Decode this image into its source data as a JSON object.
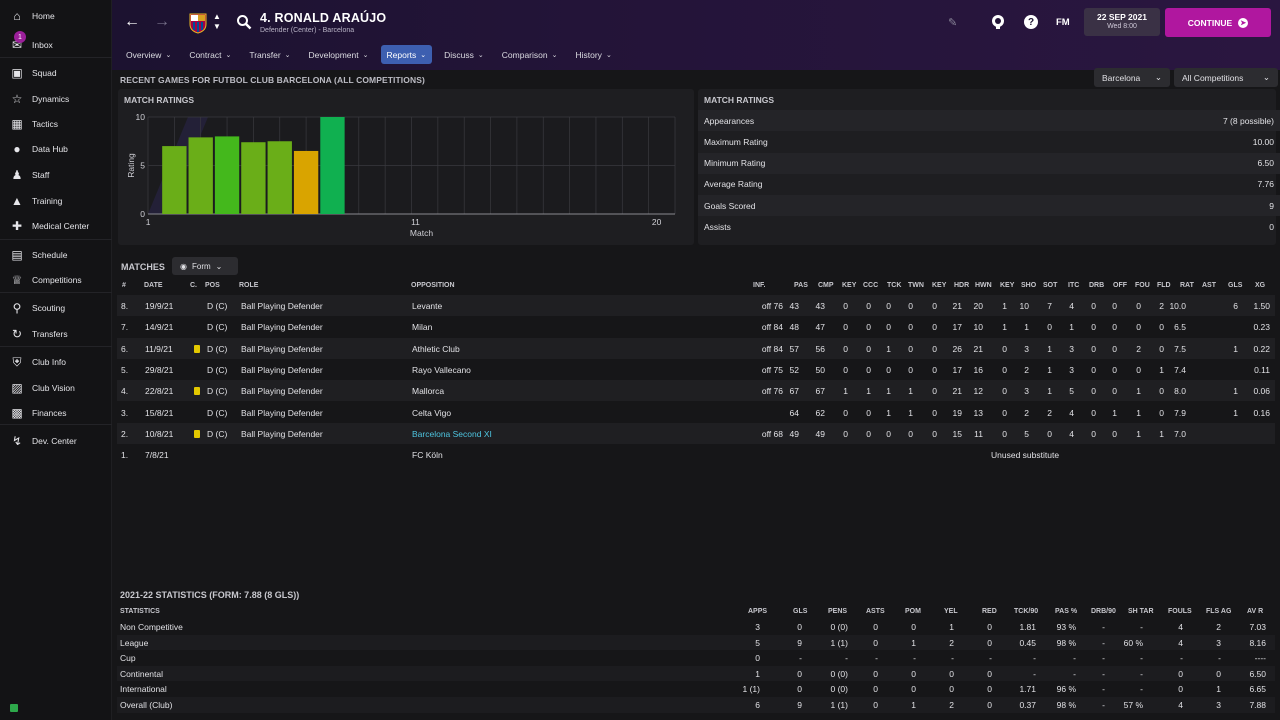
{
  "sidebar": {
    "items": [
      {
        "label": "Home",
        "icon": "home-icon"
      },
      {
        "label": "Inbox",
        "icon": "inbox-icon",
        "badge": "1"
      },
      {
        "label": "Squad",
        "icon": "squad-icon"
      },
      {
        "label": "Dynamics",
        "icon": "dynamics-icon"
      },
      {
        "label": "Tactics",
        "icon": "tactics-icon"
      },
      {
        "label": "Data Hub",
        "icon": "data-hub-icon"
      },
      {
        "label": "Staff",
        "icon": "staff-icon"
      },
      {
        "label": "Training",
        "icon": "training-icon"
      },
      {
        "label": "Medical Center",
        "icon": "medical-icon"
      },
      {
        "label": "Schedule",
        "icon": "calendar-icon"
      },
      {
        "label": "Competitions",
        "icon": "trophy-icon"
      },
      {
        "label": "Scouting",
        "icon": "scouting-icon"
      },
      {
        "label": "Transfers",
        "icon": "transfers-icon"
      },
      {
        "label": "Club Info",
        "icon": "shield-icon"
      },
      {
        "label": "Club Vision",
        "icon": "vision-icon"
      },
      {
        "label": "Finances",
        "icon": "finances-icon"
      },
      {
        "label": "Dev. Center",
        "icon": "dev-center-icon"
      }
    ]
  },
  "header": {
    "player_name": "4. RONALD ARAÚJO",
    "player_sub": "Defender (Center) - Barcelona",
    "date_main": "22 SEP 2021",
    "date_sub": "Wed 8:00",
    "continue_label": "CONTINUE",
    "fm_label": "FM",
    "tabs": [
      {
        "label": "Overview",
        "active": false
      },
      {
        "label": "Contract",
        "active": false
      },
      {
        "label": "Transfer",
        "active": false
      },
      {
        "label": "Development",
        "active": false
      },
      {
        "label": "Reports",
        "active": true
      },
      {
        "label": "Discuss",
        "active": false
      },
      {
        "label": "Comparison",
        "active": false
      },
      {
        "label": "History",
        "active": false
      }
    ]
  },
  "recent": {
    "title": "RECENT GAMES FOR FUTBOL CLUB BARCELONA (ALL COMPETITIONS)",
    "club_dd": "Barcelona",
    "comp_dd": "All Competitions"
  },
  "chart_panel_title": "MATCH RATINGS",
  "chart_data": {
    "type": "bar",
    "title": "MATCH RATINGS",
    "xlabel": "Match",
    "ylabel": "Rating",
    "ylim": [
      0,
      10
    ],
    "xlim": [
      1,
      20
    ],
    "x_ticks": [
      "1",
      "11",
      "20"
    ],
    "y_ticks": [
      "0",
      "5",
      "10"
    ],
    "categories": [
      1,
      2,
      3,
      4,
      5,
      6,
      7
    ],
    "values": [
      7.0,
      7.9,
      8.0,
      7.4,
      7.5,
      6.5,
      10.0
    ],
    "colors": [
      "#6aae18",
      "#6aae18",
      "#44b81c",
      "#6aae18",
      "#6aae18",
      "#d9a400",
      "#10b050"
    ]
  },
  "ratings": {
    "title": "MATCH RATINGS",
    "rows": [
      {
        "label": "Appearances",
        "value": "7 (8 possible)"
      },
      {
        "label": "Maximum Rating",
        "value": "10.00"
      },
      {
        "label": "Minimum Rating",
        "value": "6.50"
      },
      {
        "label": "Average Rating",
        "value": "7.76"
      },
      {
        "label": "Goals Scored",
        "value": "9"
      },
      {
        "label": "Assists",
        "value": "0"
      }
    ]
  },
  "matches": {
    "title": "MATCHES",
    "form_label": "Form",
    "headers": [
      "#",
      "DATE",
      "C.",
      "POS",
      "ROLE",
      "OPPOSITION",
      "INF.",
      "PAS",
      "CMP",
      "KEY",
      "CCC",
      "TCK",
      "TWN",
      "KEY",
      "HDR",
      "HWN",
      "KEY",
      "SHO",
      "SOT",
      "ITC",
      "DRB",
      "OFF",
      "FOU",
      "FLD",
      "RAT",
      "AST",
      "GLS",
      "XG"
    ],
    "rows": [
      {
        "num": "8.",
        "date": "19/9/21",
        "card": false,
        "pos": "D (C)",
        "role": "Ball Playing Defender",
        "opp": "Levante",
        "link": false,
        "inf": "off 76",
        "vals": [
          "43",
          "43",
          "0",
          "0",
          "0",
          "0",
          "0",
          "21",
          "20",
          "1",
          "10",
          "7",
          "4",
          "0",
          "0",
          "0",
          "2",
          "10.0",
          "",
          "6",
          "1.50"
        ]
      },
      {
        "num": "7.",
        "date": "14/9/21",
        "card": false,
        "pos": "D (C)",
        "role": "Ball Playing Defender",
        "opp": "Milan",
        "link": false,
        "inf": "off 84",
        "vals": [
          "48",
          "47",
          "0",
          "0",
          "0",
          "0",
          "0",
          "17",
          "10",
          "1",
          "1",
          "0",
          "1",
          "0",
          "0",
          "0",
          "0",
          "6.5",
          "",
          "",
          "0.23"
        ]
      },
      {
        "num": "6.",
        "date": "11/9/21",
        "card": true,
        "pos": "D (C)",
        "role": "Ball Playing Defender",
        "opp": "Athletic Club",
        "link": false,
        "inf": "off 84",
        "vals": [
          "57",
          "56",
          "0",
          "0",
          "1",
          "0",
          "0",
          "26",
          "21",
          "0",
          "3",
          "1",
          "3",
          "0",
          "0",
          "2",
          "0",
          "7.5",
          "",
          "1",
          "0.22"
        ]
      },
      {
        "num": "5.",
        "date": "29/8/21",
        "card": false,
        "pos": "D (C)",
        "role": "Ball Playing Defender",
        "opp": "Rayo Vallecano",
        "link": false,
        "inf": "off 75",
        "vals": [
          "52",
          "50",
          "0",
          "0",
          "0",
          "0",
          "0",
          "17",
          "16",
          "0",
          "2",
          "1",
          "3",
          "0",
          "0",
          "0",
          "1",
          "7.4",
          "",
          "",
          "0.11"
        ]
      },
      {
        "num": "4.",
        "date": "22/8/21",
        "card": true,
        "pos": "D (C)",
        "role": "Ball Playing Defender",
        "opp": "Mallorca",
        "link": false,
        "inf": "off 76",
        "vals": [
          "67",
          "67",
          "1",
          "1",
          "1",
          "1",
          "0",
          "21",
          "12",
          "0",
          "3",
          "1",
          "5",
          "0",
          "0",
          "1",
          "0",
          "8.0",
          "",
          "1",
          "0.06"
        ]
      },
      {
        "num": "3.",
        "date": "15/8/21",
        "card": false,
        "pos": "D (C)",
        "role": "Ball Playing Defender",
        "opp": "Celta Vigo",
        "link": false,
        "inf": "",
        "vals": [
          "64",
          "62",
          "0",
          "0",
          "1",
          "1",
          "0",
          "19",
          "13",
          "0",
          "2",
          "2",
          "4",
          "0",
          "1",
          "1",
          "0",
          "7.9",
          "",
          "1",
          "0.16"
        ]
      },
      {
        "num": "2.",
        "date": "10/8/21",
        "card": true,
        "pos": "D (C)",
        "role": "Ball Playing Defender",
        "opp": "Barcelona Second XI",
        "link": true,
        "inf": "off 68",
        "vals": [
          "49",
          "49",
          "0",
          "0",
          "0",
          "0",
          "0",
          "15",
          "11",
          "0",
          "5",
          "0",
          "4",
          "0",
          "0",
          "1",
          "1",
          "7.0",
          "",
          "",
          ""
        ]
      }
    ],
    "last_row": {
      "num": "1.",
      "date": "7/8/21",
      "opp": "FC Köln",
      "note": "Unused substitute"
    }
  },
  "season_stats": {
    "title": "2021-22 STATISTICS (FORM: 7.88 (8 GLS))",
    "headers": [
      "STATISTICS",
      "APPS",
      "GLS",
      "PENS",
      "ASTS",
      "POM",
      "YEL",
      "RED",
      "TCK/90",
      "PAS %",
      "DRB/90",
      "SH TAR",
      "FOULS",
      "FLS AG",
      "AV R"
    ],
    "rows": [
      {
        "name": "Non Competitive",
        "vals": [
          "3",
          "0",
          "0 (0)",
          "0",
          "0",
          "1",
          "0",
          "1.81",
          "93 %",
          "-",
          "-",
          "4",
          "2",
          "7.03"
        ]
      },
      {
        "name": "League",
        "vals": [
          "5",
          "9",
          "1 (1)",
          "0",
          "1",
          "2",
          "0",
          "0.45",
          "98 %",
          "-",
          "60 %",
          "4",
          "3",
          "8.16"
        ]
      },
      {
        "name": "Cup",
        "vals": [
          "0",
          "-",
          "-",
          "-",
          "-",
          "-",
          "-",
          "-",
          "-",
          "-",
          "-",
          "-",
          "-",
          "----"
        ]
      },
      {
        "name": "Continental",
        "vals": [
          "1",
          "0",
          "0 (0)",
          "0",
          "0",
          "0",
          "0",
          "-",
          "-",
          "-",
          "-",
          "0",
          "0",
          "6.50"
        ]
      },
      {
        "name": "International",
        "vals": [
          "1 (1)",
          "0",
          "0 (0)",
          "0",
          "0",
          "0",
          "0",
          "1.71",
          "96 %",
          "-",
          "-",
          "0",
          "1",
          "6.65"
        ]
      },
      {
        "name": "Overall (Club)",
        "vals": [
          "6",
          "9",
          "1 (1)",
          "0",
          "1",
          "2",
          "0",
          "0.37",
          "98 %",
          "-",
          "57 %",
          "4",
          "3",
          "7.88"
        ]
      }
    ]
  }
}
